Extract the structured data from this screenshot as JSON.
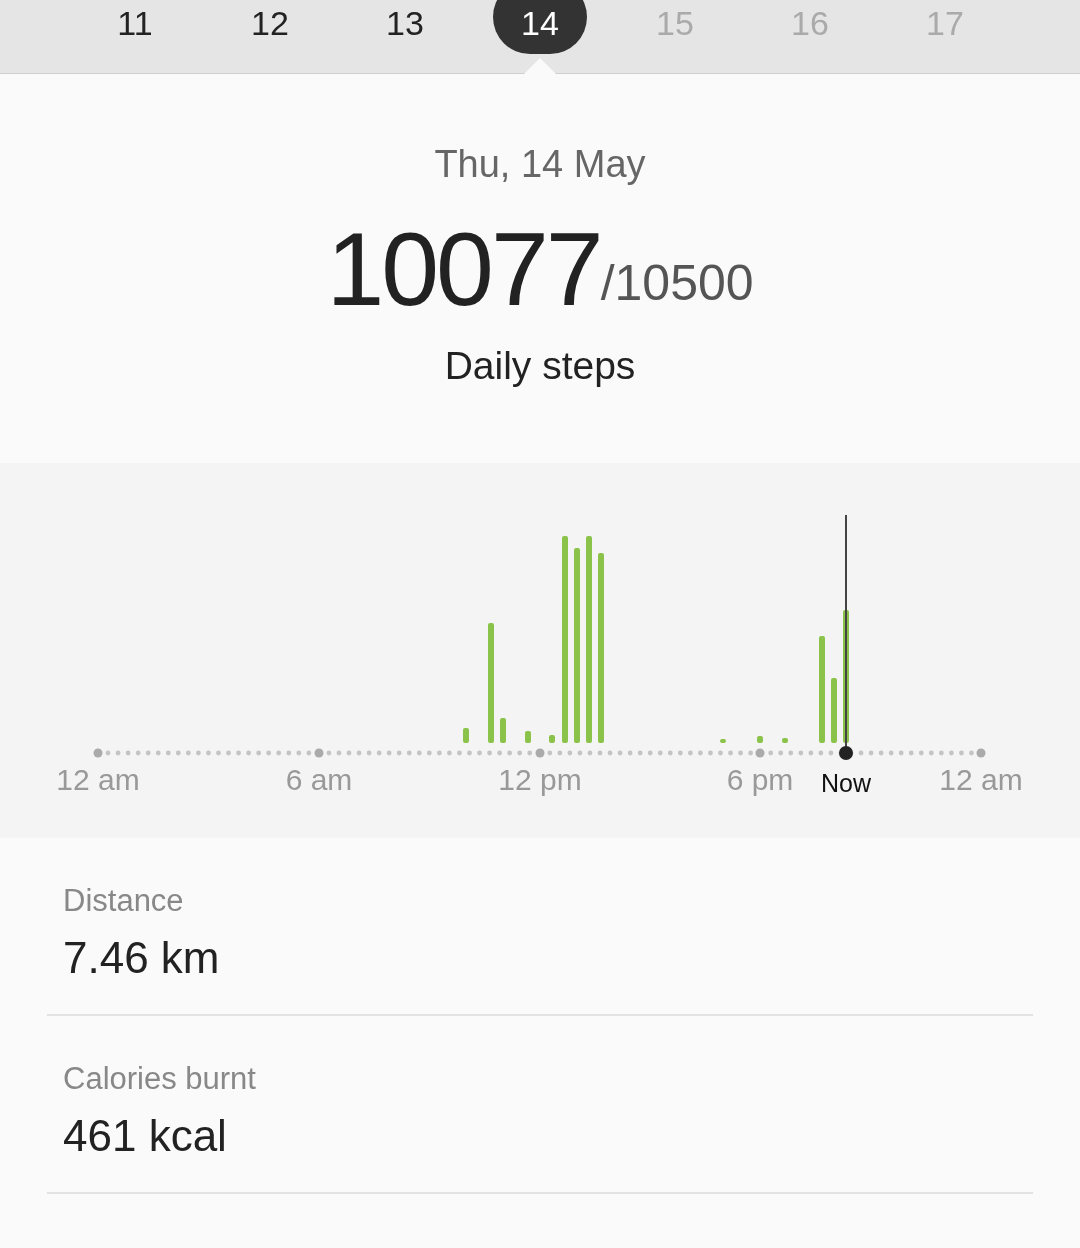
{
  "date_strip": [
    {
      "label": "11",
      "selected": false,
      "dimmed": false
    },
    {
      "label": "12",
      "selected": false,
      "dimmed": false
    },
    {
      "label": "13",
      "selected": false,
      "dimmed": false
    },
    {
      "label": "14",
      "selected": true,
      "dimmed": false
    },
    {
      "label": "15",
      "selected": false,
      "dimmed": true
    },
    {
      "label": "16",
      "selected": false,
      "dimmed": true
    },
    {
      "label": "17",
      "selected": false,
      "dimmed": true
    }
  ],
  "summary": {
    "date": "Thu, 14 May",
    "steps": "10077",
    "goal": "/10500",
    "caption": "Daily steps"
  },
  "timeline": {
    "axis_labels": [
      {
        "label": "12 am",
        "kind": "tick"
      },
      {
        "label": "6 am",
        "kind": "tick"
      },
      {
        "label": "12 pm",
        "kind": "tick"
      },
      {
        "label": "6 pm",
        "kind": "tick"
      },
      {
        "label": "Now",
        "kind": "now"
      },
      {
        "label": "12 am",
        "kind": "tick"
      }
    ]
  },
  "stats": [
    {
      "label": "Distance",
      "value": "7.46 km"
    },
    {
      "label": "Calories burnt",
      "value": "461 kcal"
    }
  ]
}
